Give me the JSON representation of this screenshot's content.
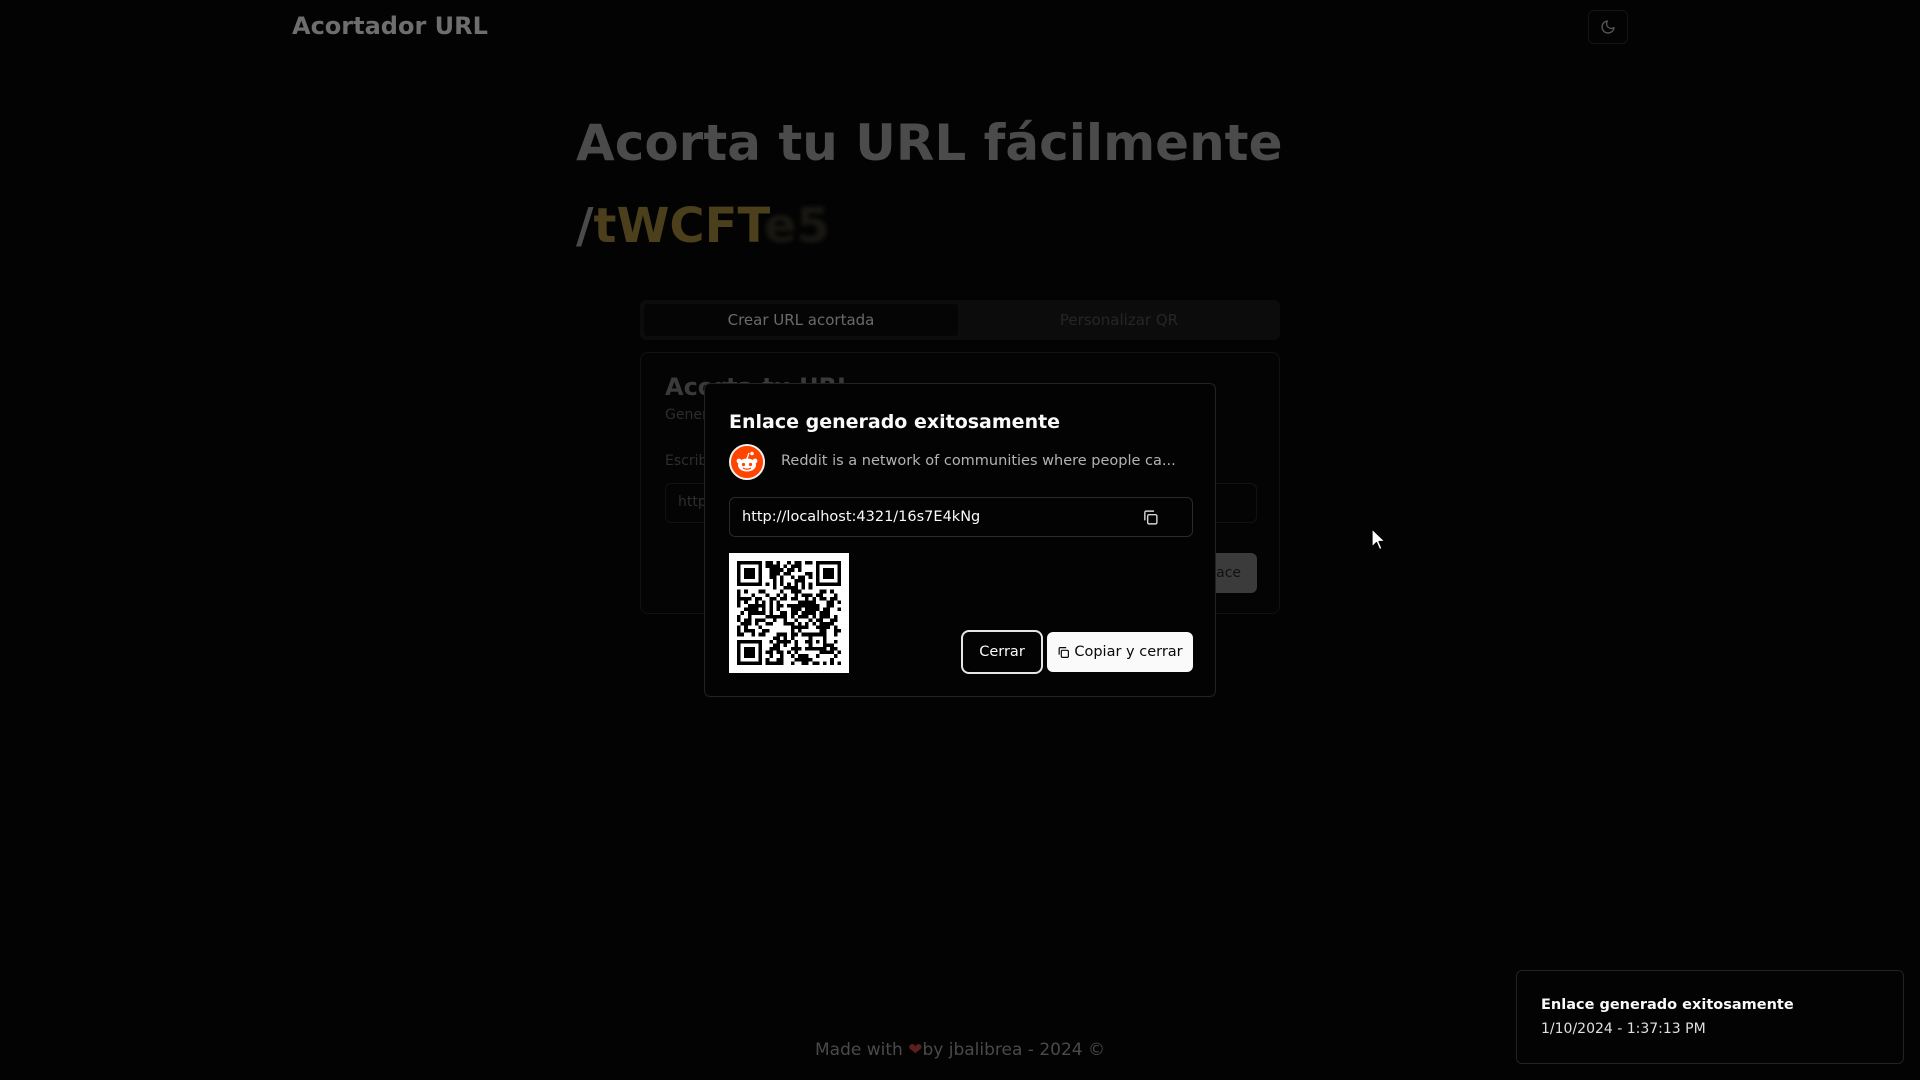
{
  "header": {
    "brand": "Acortador URL",
    "theme_toggle_icon": "moon-icon"
  },
  "hero": {
    "title": "Acorta tu URL fácilmente",
    "slug_prefix": "/tWCFT",
    "slug_fading": "e5"
  },
  "tabs": [
    {
      "label": "Crear URL acortada",
      "active": true
    },
    {
      "label": "Personalizar QR",
      "active": false
    }
  ],
  "card": {
    "title": "Acorta tu URL",
    "description": "Gener",
    "field_label": "Escrib",
    "input_value": "http",
    "submit_label": "ace"
  },
  "modal": {
    "title": "Enlace generado exitosamente",
    "site_logo_icon": "reddit-icon",
    "site_description": "Reddit is a network of communities where people ca...",
    "short_url": "http://localhost:4321/16s7E4kNg",
    "copy_icon": "copy-icon",
    "close_label": "Cerrar",
    "copy_close_label": "Copiar y cerrar"
  },
  "toast": {
    "title": "Enlace generado exitosamente",
    "timestamp": "1/10/2024 - 1:37:13 PM"
  },
  "footer": {
    "made_with": "Made with",
    "heart": "❤",
    "by_text": "by jbalibrea - 2024 ©"
  },
  "colors": {
    "accent_gold": "#4b3f1c",
    "reddit_orange": "#ff4500",
    "modal_background": "#030303"
  }
}
